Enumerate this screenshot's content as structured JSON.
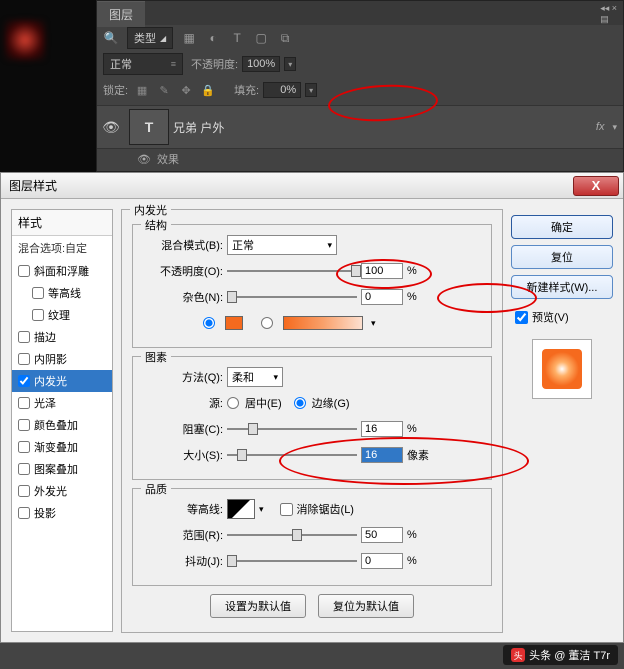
{
  "layers_panel": {
    "tab": "图层",
    "filter_label": "类型",
    "blend_mode": "正常",
    "opacity_label": "不透明度:",
    "opacity_value": "100%",
    "lock_label": "锁定:",
    "fill_label": "填充:",
    "fill_value": "0%",
    "layer_thumb": "T",
    "layer_name": "兄弟 户外",
    "layer_fx": "fx",
    "sub_effect": "效果"
  },
  "dialog": {
    "title": "图层样式",
    "close": "X",
    "styles_header": "样式",
    "blend_options": "混合选项:自定",
    "items": {
      "bevel": "斜面和浮雕",
      "contour": "等高线",
      "texture": "纹理",
      "stroke": "描边",
      "inner_shadow": "内阴影",
      "inner_glow": "内发光",
      "satin": "光泽",
      "color_overlay": "颜色叠加",
      "gradient_overlay": "渐变叠加",
      "pattern_overlay": "图案叠加",
      "outer_glow": "外发光",
      "drop_shadow": "投影"
    },
    "inner_glow": {
      "box_title": "内发光",
      "structure": "结构",
      "blend_mode_label": "混合模式(B):",
      "blend_mode_value": "正常",
      "opacity_label": "不透明度(O):",
      "opacity_value": "100",
      "noise_label": "杂色(N):",
      "noise_value": "0",
      "elements": "图素",
      "technique_label": "方法(Q):",
      "technique_value": "柔和",
      "source_label": "源:",
      "source_center": "居中(E)",
      "source_edge": "边缘(G)",
      "choke_label": "阻塞(C):",
      "choke_value": "16",
      "size_label": "大小(S):",
      "size_value": "16",
      "size_unit": "像素",
      "quality": "品质",
      "contour_label": "等高线:",
      "antialias": "消除锯齿(L)",
      "range_label": "范围(R):",
      "range_value": "50",
      "jitter_label": "抖动(J):",
      "jitter_value": "0",
      "pct": "%"
    },
    "set_default": "设置为默认值",
    "reset_default": "复位为默认值",
    "buttons": {
      "ok": "确定",
      "cancel": "复位",
      "new_style": "新建样式(W)...",
      "preview": "预览(V)"
    }
  },
  "watermark": "头条 @ 董洁 T7r"
}
